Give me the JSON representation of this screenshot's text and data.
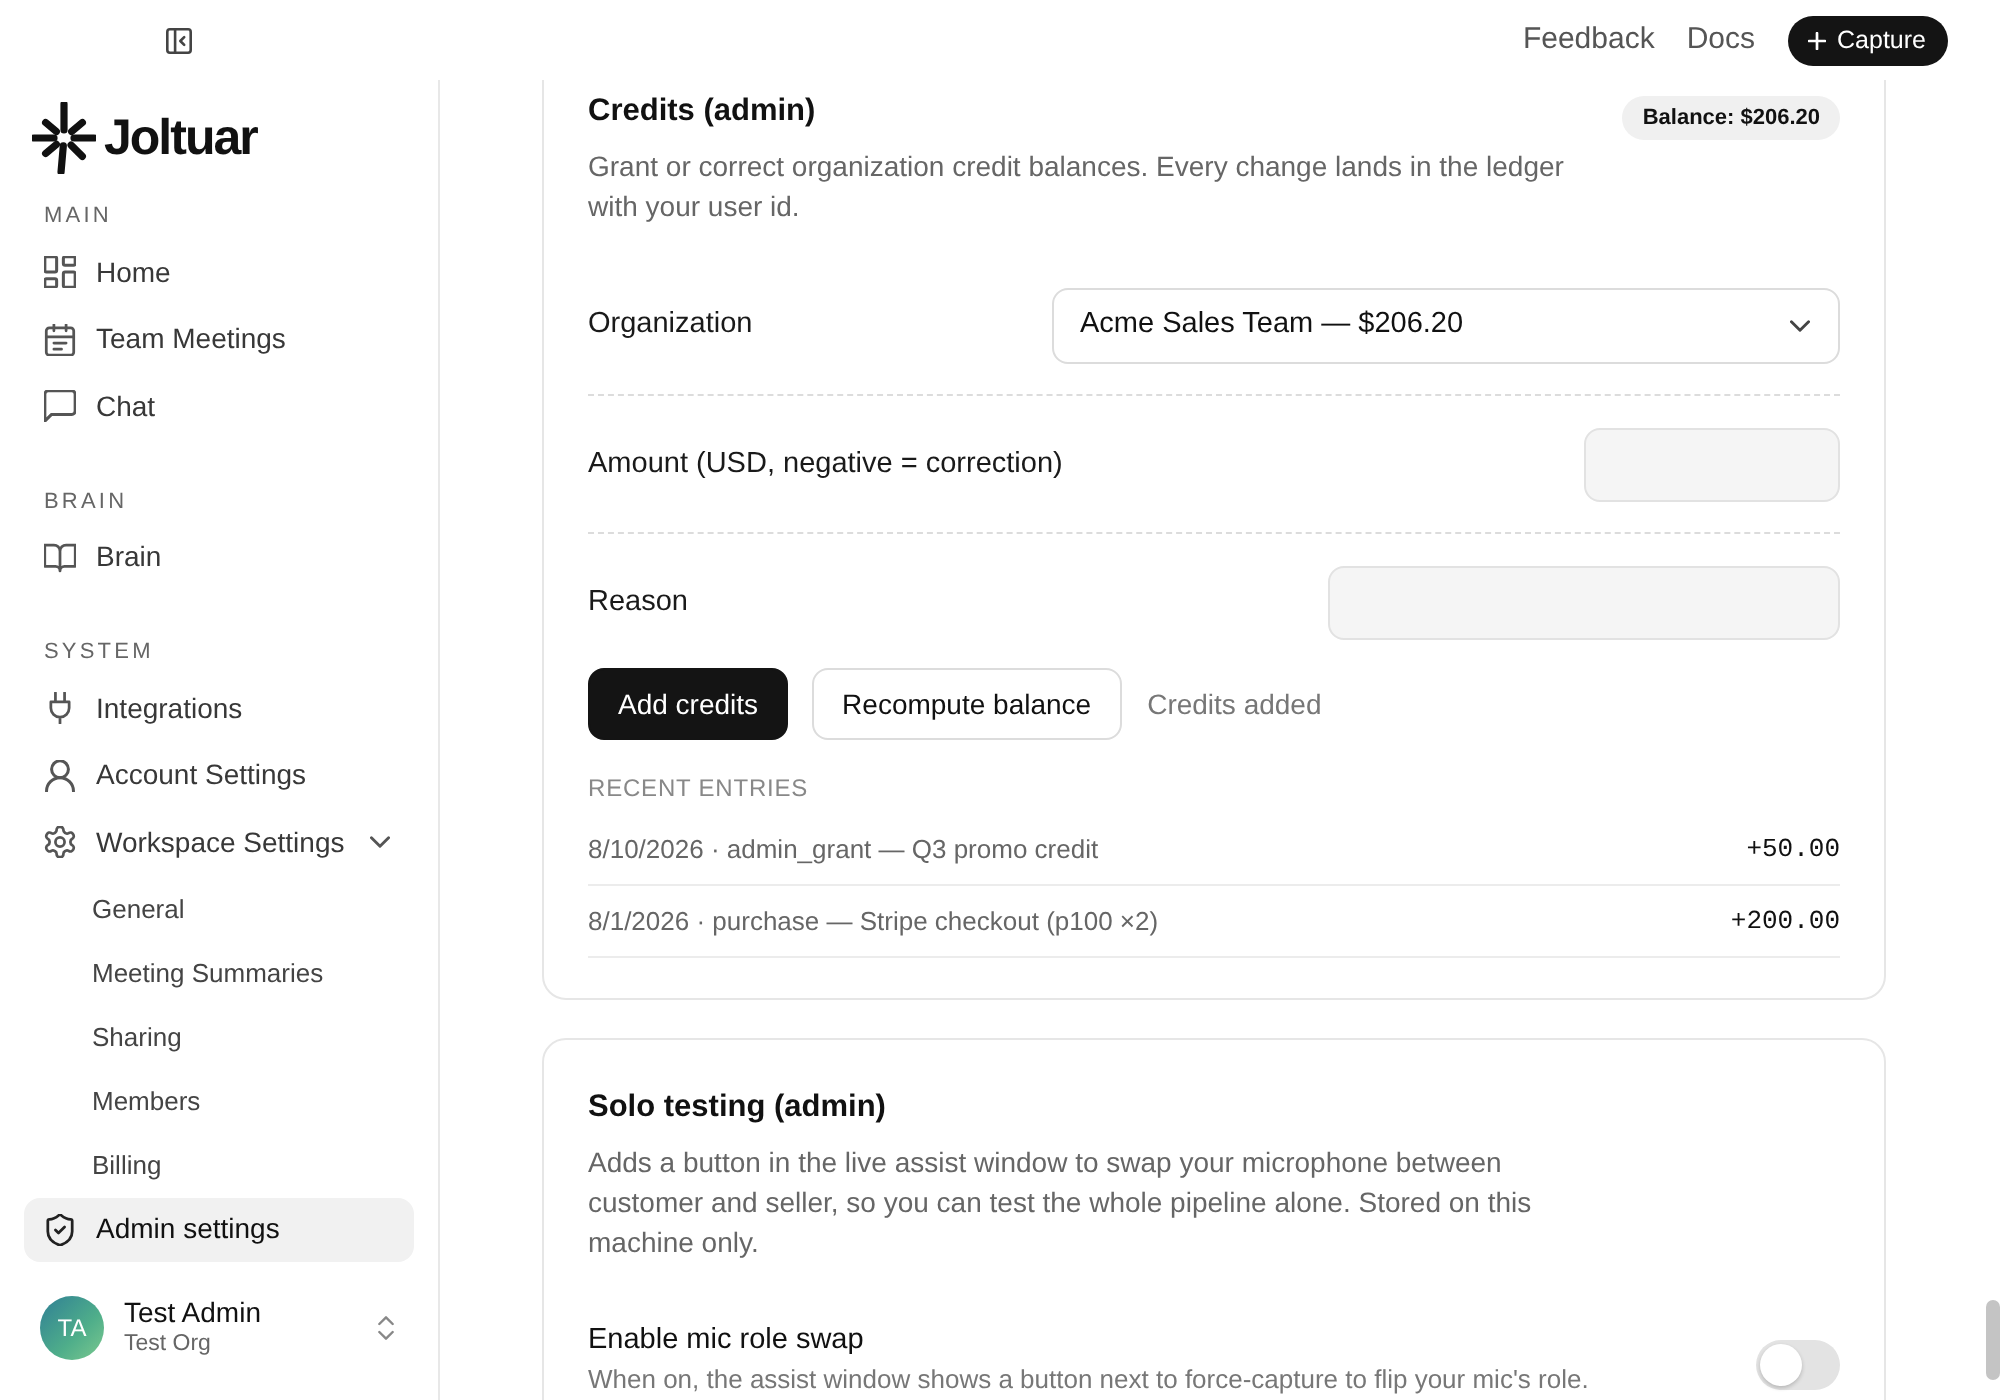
{
  "top_bar": {
    "links": [
      "Feedback",
      "Docs"
    ],
    "capture_button": "Capture"
  },
  "sidebar": {
    "logo": "Joltuar",
    "sections": [
      {
        "heading": "MAIN",
        "items": [
          {
            "label": "Home",
            "selected": false
          },
          {
            "label": "Team Meetings",
            "selected": false
          },
          {
            "label": "Chat",
            "selected": false
          }
        ]
      },
      {
        "heading": "BRAIN",
        "items": [
          {
            "label": "Brain",
            "selected": false
          }
        ]
      },
      {
        "heading": "SYSTEM",
        "items": [
          {
            "label": "Integrations",
            "selected": false
          },
          {
            "label": "Account Settings",
            "selected": false
          },
          {
            "label": "Workspace Settings",
            "selected": false,
            "expanded": true,
            "children": [
              {
                "label": "General",
                "selected": false
              },
              {
                "label": "Meeting Summaries",
                "selected": false
              },
              {
                "label": "Sharing",
                "selected": false
              },
              {
                "label": "Members",
                "selected": false
              },
              {
                "label": "Billing",
                "selected": false
              }
            ]
          },
          {
            "label": "Admin settings",
            "selected": true
          }
        ]
      }
    ],
    "user": {
      "initials": "TA",
      "name": "Test Admin",
      "org": "Test Org"
    }
  },
  "credits_card": {
    "title": "Credits (admin)",
    "badge": "Balance: $206.20",
    "description": "Grant or correct organization credit balances. Every change lands in the ledger with your user id.",
    "fields": [
      {
        "kind": "select",
        "label": "Organization",
        "value": "Acme Sales Team — $206.20"
      },
      {
        "kind": "number",
        "label": "Amount (USD, negative = correction)"
      },
      {
        "kind": "text",
        "label": "Reason"
      }
    ],
    "buttons": [
      {
        "kind": "primary",
        "label": "Add credits"
      },
      {
        "kind": "secondary",
        "label": "Recompute balance"
      }
    ],
    "status": "Credits added",
    "recent_heading": "RECENT ENTRIES",
    "entries": [
      {
        "text": "8/10/2026 · admin_grant — Q3 promo credit",
        "amount": "+50.00"
      },
      {
        "text": "8/1/2026 · purchase — Stripe checkout (p100 ×2)",
        "amount": "+200.00"
      }
    ]
  },
  "solo_testing_card": {
    "title": "Solo testing (admin)",
    "description": "Adds a button in the live assist window to swap your microphone between customer and seller, so you can test the whole pipeline alone. Stored on this machine only.",
    "settings": [
      {
        "label": "Enable mic role swap",
        "description": "When on, the assist window shows a button next to force-capture to flip your mic's role.",
        "on": false
      }
    ]
  }
}
